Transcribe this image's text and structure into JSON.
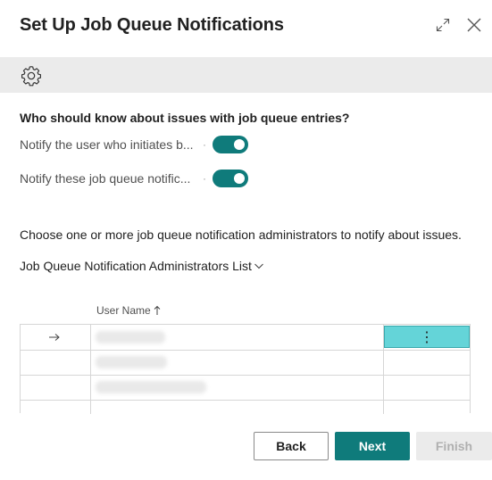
{
  "dialog": {
    "title": "Set Up Job Queue Notifications",
    "expand_icon": "expand-diagonal-icon",
    "close_icon": "close-icon"
  },
  "actionbar": {
    "icon": "gear-icon"
  },
  "content": {
    "question": "Who should know about issues with job queue entries?",
    "fields": [
      {
        "label": "Notify the user who initiates b...",
        "value": true
      },
      {
        "label": "Notify these job queue notific...",
        "value": true
      }
    ],
    "info": "Choose one or more job queue notification administrators to notify about issues.",
    "part_link": "Job Queue Notification Administrators List"
  },
  "list": {
    "column_header": "User Name",
    "sort_icon": "sort-ascending-icon",
    "row_indicator_icon": "arrow-right-icon",
    "more_options": "⋮",
    "row_count_visible": 3
  },
  "footer": {
    "back_label": "Back",
    "next_label": "Next",
    "finish_label": "Finish"
  },
  "colors": {
    "accent": "#0f7b7b",
    "selected_cell": "#64d4d8",
    "actionbar_bg": "#ebebeb"
  }
}
